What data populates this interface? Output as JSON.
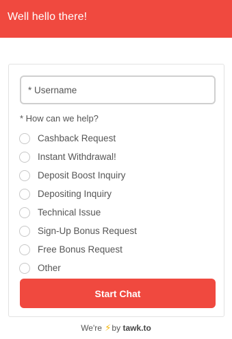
{
  "header": {
    "title": "Well hello there!"
  },
  "form": {
    "username_placeholder": "* Username",
    "help_label": "* How can we help?",
    "options": [
      {
        "label": "Cashback Request"
      },
      {
        "label": "Instant Withdrawal!"
      },
      {
        "label": "Deposit Boost Inquiry"
      },
      {
        "label": "Depositing Inquiry"
      },
      {
        "label": "Technical Issue"
      },
      {
        "label": "Sign-Up Bonus Request"
      },
      {
        "label": "Free Bonus Request"
      },
      {
        "label": "Other"
      }
    ],
    "submit_label": "Start Chat"
  },
  "footer": {
    "prefix": "We're",
    "by": "by",
    "brand": "tawk.to",
    "icon": "lightning-bolt-icon"
  },
  "colors": {
    "accent": "#f0493f",
    "bolt": "#f5b400"
  }
}
